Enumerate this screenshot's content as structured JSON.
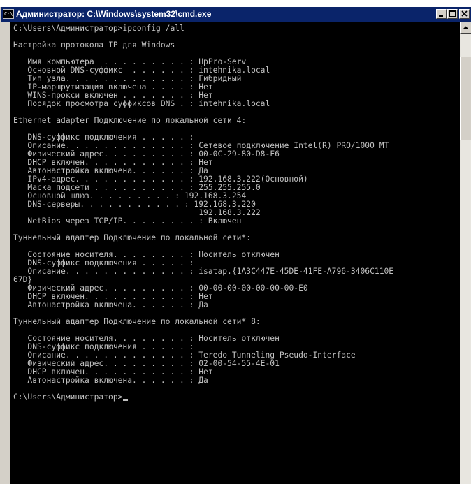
{
  "window": {
    "title": "Администратор: C:\\Windows\\system32\\cmd.exe",
    "icon_text": "C:\\"
  },
  "console": {
    "lines": [
      "C:\\Users\\Администратор>ipconfig /all",
      "",
      "Настройка протокола IP для Windows",
      "",
      "   Имя компьютера  . . . . . . . . . : HpPro-Serv",
      "   Основной DNS-суффикс  . . . . . . : intehnika.local",
      "   Тип узла. . . . . . . . . . . . . : Гибридный",
      "   IP-маршрутизация включена . . . . : Нет",
      "   WINS-прокси включен . . . . . . . : Нет",
      "   Порядок просмотра суффиксов DNS . : intehnika.local",
      "",
      "Ethernet adapter Подключение по локальной сети 4:",
      "",
      "   DNS-суффикс подключения . . . . . :",
      "   Описание. . . . . . . . . . . . . : Сетевое подключение Intel(R) PRO/1000 MT",
      "   Физический адрес. . . . . . . . . : 00-0C-29-80-D8-F6",
      "   DHCP включен. . . . . . . . . . . : Нет",
      "   Автонастройка включена. . . . . . : Да",
      "   IPv4-адрес. . . . . . . . . . . . : 192.168.3.222(Основной)",
      "   Маска подсети . . . . . . . . . . : 255.255.255.0",
      "   Основной шлюз. . . . . . . . . : 192.168.3.254",
      "   DNS-серверы. . . . . . . . . . . : 192.168.3.220",
      "                                       192.168.3.222",
      "   NetBios через TCP/IP. . . . . . . . : Включен",
      "",
      "Туннельный адаптер Подключение по локальной сети*:",
      "",
      "   Состояние носителя. . . . . . . . : Носитель отключен",
      "   DNS-суффикс подключения . . . . . :",
      "   Описание. . . . . . . . . . . . . : isatap.{1A3C447E-45DE-41FE-A796-3406C110E",
      "67D}",
      "   Физический адрес. . . . . . . . . : 00-00-00-00-00-00-00-E0",
      "   DHCP включен. . . . . . . . . . . : Нет",
      "   Автонастройка включена. . . . . . : Да",
      "",
      "Туннельный адаптер Подключение по локальной сети* 8:",
      "",
      "   Состояние носителя. . . . . . . . : Носитель отключен",
      "   DNS-суффикс подключения . . . . . :",
      "   Описание. . . . . . . . . . . . . : Teredo Tunneling Pseudo-Interface",
      "   Физический адрес. . . . . . . . . : 02-00-54-55-4E-01",
      "   DHCP включен. . . . . . . . . . . : Нет",
      "   Автонастройка включена. . . . . . : Да",
      ""
    ],
    "prompt": "C:\\Users\\Администратор>"
  },
  "icons": {
    "window": "cmd-icon",
    "minimize": "minimize-icon",
    "maximize": "maximize-icon",
    "close": "close-icon",
    "scroll_up": "arrow-up-icon"
  },
  "colors": {
    "titlebar": "#0a246a",
    "console_bg": "#000000",
    "console_text": "#c0c0c0",
    "chrome": "#d4d0c8"
  }
}
